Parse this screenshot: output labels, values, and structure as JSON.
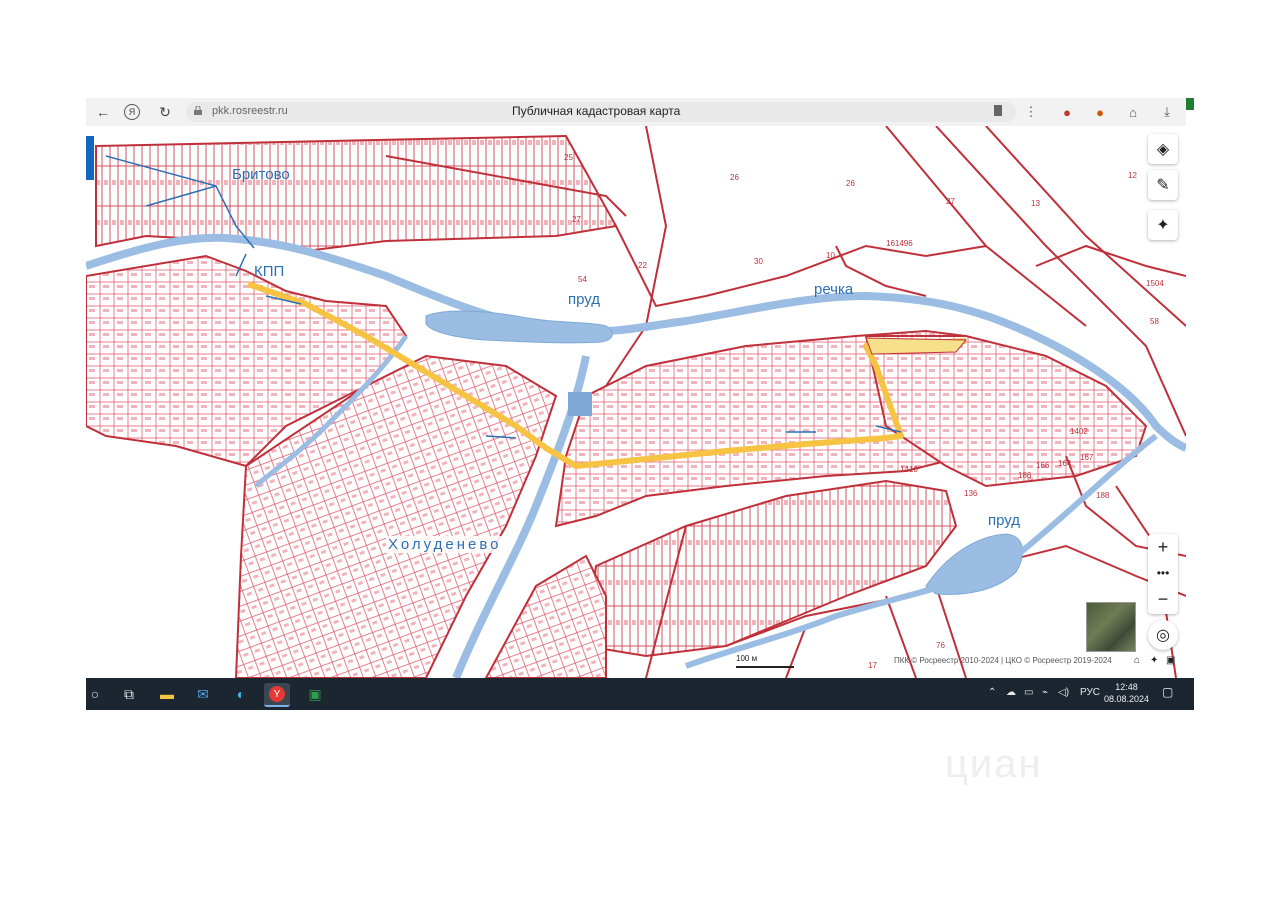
{
  "browser": {
    "url": "pkk.rosreestr.ru",
    "title": "Публичная кадастровая карта"
  },
  "map": {
    "labels": {
      "britovo": "Бритово",
      "kpp": "КПП",
      "pond1": "пруд",
      "river": "речка",
      "pond2": "пруд",
      "village": "Холуденево"
    },
    "parcel_numbers": [
      "25",
      "26",
      "26",
      "27",
      "13",
      "12",
      "30",
      "10",
      "22",
      "54",
      "27",
      "58",
      "161496",
      "1504",
      "188",
      "76",
      "17",
      "1410",
      "1402",
      "166",
      "164",
      "167",
      "186",
      "136"
    ],
    "scale": "100 м",
    "copyright": "ПКК © Росреестр 2010-2024 | ЦКО © Росреестр 2019-2024"
  },
  "taskbar": {
    "language": "РУС",
    "time": "12:48",
    "date": "08.08.2024"
  },
  "colors": {
    "parcel_border": "#d2404a",
    "water": "#9bbde3",
    "route": "#f6c343",
    "label": "#2b6fb4"
  }
}
